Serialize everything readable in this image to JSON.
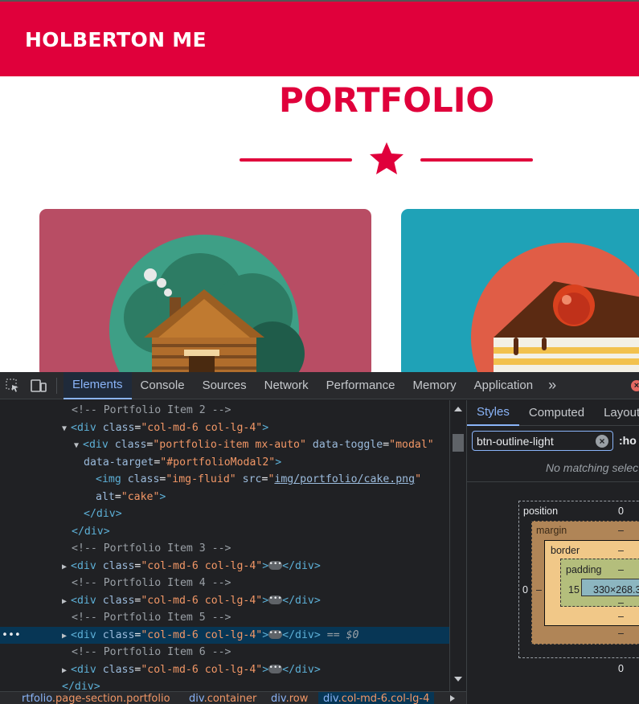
{
  "site": {
    "brand": "HOLBERTON ME",
    "title": "PORTFOLIO",
    "colors": {
      "accent": "#e0003b",
      "card1": "#b84d64",
      "card2": "#1fa2b7"
    }
  },
  "devtools": {
    "tabs": [
      "Elements",
      "Console",
      "Sources",
      "Network",
      "Performance",
      "Memory",
      "Application"
    ],
    "more": "»",
    "active_tab": "Elements",
    "dom": {
      "l1": "<!-- Portfolio Item 2 -->",
      "l2_tag_open": "<div ",
      "l2_attr": "class",
      "l2_val": "\"col-md-6 col-lg-4\"",
      "l3_tag_open": "<div ",
      "l3_attr1": "class",
      "l3_val1": "\"portfolio-item mx-auto\"",
      "l3_attr2": "data-toggle",
      "l3_val2": "\"modal\"",
      "l4_attr": "data-target",
      "l4_val": "\"#portfolioModal2\"",
      "l5_tag_open": "<img ",
      "l5_attr1": "class",
      "l5_val1": "\"img-fluid\"",
      "l5_attr2": "src",
      "l5_val2": "img/portfolio/cake.png",
      "l6_attr": "alt",
      "l6_val": "\"cake\"",
      "l7": "</div>",
      "l8": "</div>",
      "l9": "<!-- Portfolio Item 3 -->",
      "l11": "<!-- Portfolio Item 4 -->",
      "l13": "<!-- Portfolio Item 5 -->",
      "l15": "<!-- Portfolio Item 6 -->",
      "collapsed_open": "<div ",
      "collapsed_attr": "class",
      "collapsed_val": "\"col-md-6 col-lg-4\"",
      "collapsed_close": "</div>",
      "ellipsis": "•••",
      "selected_marker": "== $0",
      "row_dots": "•••",
      "last": "</div>"
    },
    "breadcrumbs": [
      {
        "tag": "rtfolio",
        "cls": ".page-section.portfolio"
      },
      {
        "tag": "div",
        "cls": ".container"
      },
      {
        "tag": "div",
        "cls": ".row"
      },
      {
        "tag": "div",
        "cls": ".col-md-6.col-lg-4"
      }
    ],
    "styles": {
      "tabs": [
        "Styles",
        "Computed",
        "Layout"
      ],
      "filter_value": "btn-outline-light",
      "hov": ":ho",
      "no_match": "No matching selec",
      "box_model": {
        "position_label": "position",
        "position_top": "0",
        "position_bottom": "0",
        "position_left": "0",
        "margin_label": "margin",
        "margin_top": "–",
        "margin_bottom": "–",
        "margin_left": "–",
        "border_label": "border",
        "border_top": "–",
        "border_bottom": "–",
        "padding_label": "padding",
        "padding_top": "–",
        "padding_bottom": "–",
        "padding_left": "15",
        "content": "330×268.3"
      }
    }
  }
}
